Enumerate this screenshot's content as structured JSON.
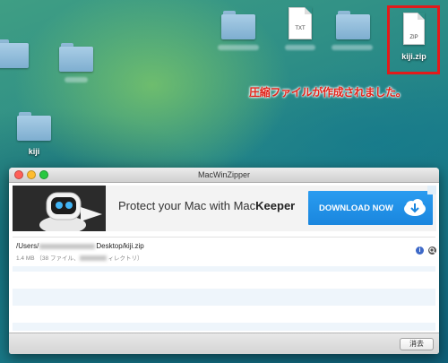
{
  "desktop": {
    "icons": [
      {
        "label": "kiji"
      },
      {
        "label": "TXT"
      },
      {
        "label": "ZIP"
      },
      {
        "label": "kiji.zip"
      }
    ],
    "notice": "圧縮ファイルが作成されました。",
    "highlight_color": "#e21b1b"
  },
  "window": {
    "title": "MacWinZipper",
    "traffic_colors": [
      "#ff5f57",
      "#febc2e",
      "#28c840"
    ]
  },
  "ad": {
    "text_prefix": "Protect your Mac with Mac",
    "text_brand": "Keeper",
    "button_label": "DOWNLOAD NOW",
    "button_color": "#1a86de"
  },
  "file": {
    "path_prefix": "/Users/",
    "path_suffix": "Desktop/kiji.zip",
    "size": "1.4 MB",
    "meta_open": "（38 ファイル、",
    "meta_close": "ィレクトリ）",
    "info_glyph": "i",
    "search_glyph": "🔍"
  },
  "bottom": {
    "clear_label": "消去"
  }
}
